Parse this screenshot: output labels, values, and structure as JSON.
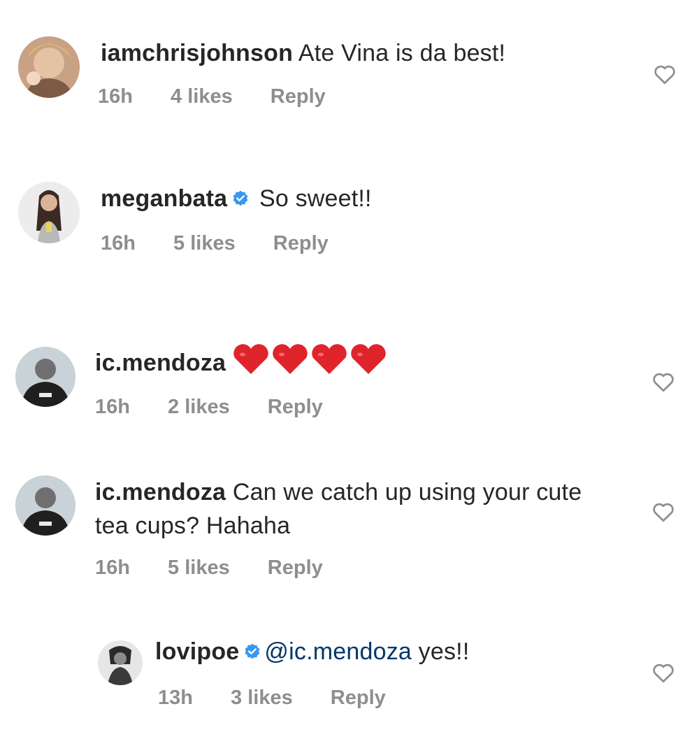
{
  "comments": [
    {
      "username": "iamchrisjohnson",
      "verified": false,
      "text": " Ate Vina is da best!",
      "time": "16h",
      "likes": "4 likes",
      "reply": "Reply",
      "avatar_icon": "avatar-photo"
    },
    {
      "username": "meganbata",
      "verified": true,
      "text": " So sweet!!",
      "time": "16h",
      "likes": "5 likes",
      "reply": "Reply",
      "avatar_icon": "avatar-photo"
    },
    {
      "username": "ic.mendoza",
      "verified": false,
      "text": "",
      "emoji": "❤️❤️❤️❤️",
      "time": "16h",
      "likes": "2 likes",
      "reply": "Reply",
      "avatar_icon": "avatar-photo"
    },
    {
      "username": "ic.mendoza",
      "verified": false,
      "text": " Can we catch up using your cute tea cups? Hahaha",
      "time": "16h",
      "likes": "5 likes",
      "reply": "Reply",
      "avatar_icon": "avatar-photo"
    },
    {
      "username": "lovipoe",
      "verified": true,
      "mention": "@ic.mendoza",
      "text": " yes!!",
      "time": "13h",
      "likes": "3 likes",
      "reply": "Reply",
      "avatar_icon": "avatar-photo"
    }
  ],
  "colors": {
    "text": "#262626",
    "meta": "#8e8e8e",
    "verified": "#3897f0",
    "mention": "#00376b",
    "heart_emoji": "#e0242c"
  },
  "icons": {
    "like": "heart-outline-icon",
    "verified": "verified-badge-icon"
  }
}
